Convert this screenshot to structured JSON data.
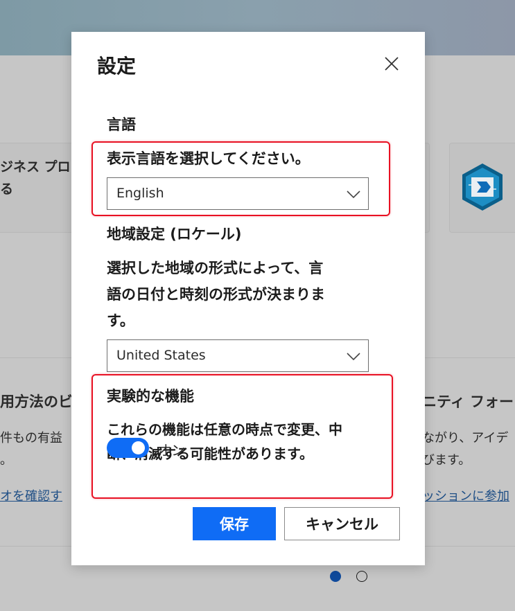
{
  "background": {
    "card_left_line1": "ジネス プロ",
    "card_left_line2": "る",
    "section_left_title": "用方法のビ",
    "section_left_line1": "件もの有益",
    "section_left_line2": "。",
    "section_left_link": "オを確認す",
    "section_right_title": "ニティ フォー",
    "section_right_line1": "ながり、アイデ",
    "section_right_line2": "びます。",
    "section_right_link": "ッションに参加",
    "carousel_page_count": 2,
    "carousel_active_index": 0,
    "logo_icon": "power-automate-icon"
  },
  "dialog": {
    "title": "設定",
    "close_icon": "close-icon",
    "language": {
      "section_label": "言語",
      "prompt": "表示言語を選択してください。",
      "selected": "English",
      "chevron_icon": "chevron-down-icon"
    },
    "locale": {
      "section_label": "地域設定 (ロケール)",
      "description_line1": "選択した地域の形式によって、言",
      "description_line2": "語の日付と時刻の形式が決まりま",
      "description_line3": "す。",
      "selected": "United States",
      "chevron_icon": "chevron-down-icon"
    },
    "experimental": {
      "section_label": "実験的な機能",
      "description_line1": "これらの機能は任意の時点で変更、中",
      "description_line2": "断、消滅する可能性があります。",
      "toggle_on": true,
      "toggle_label": "オン"
    },
    "save_label": "保存",
    "cancel_label": "キャンセル"
  },
  "colors": {
    "accent": "#0f6cf5",
    "highlight_border": "#e81123"
  }
}
